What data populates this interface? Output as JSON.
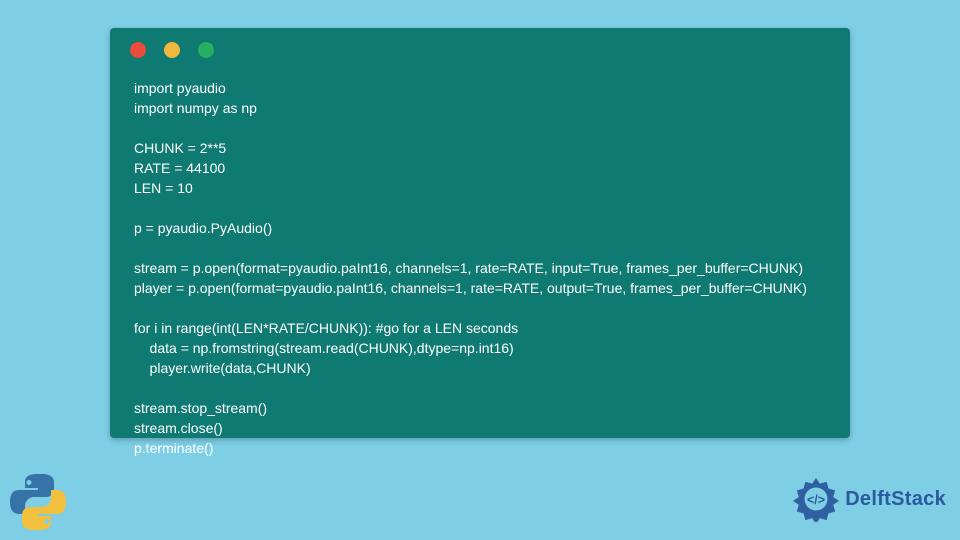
{
  "code": {
    "lines": [
      "import pyaudio",
      "import numpy as np",
      "",
      "CHUNK = 2**5",
      "RATE = 44100",
      "LEN = 10",
      "",
      "p = pyaudio.PyAudio()",
      "",
      "stream = p.open(format=pyaudio.paInt16, channels=1, rate=RATE, input=True, frames_per_buffer=CHUNK)",
      "player = p.open(format=pyaudio.paInt16, channels=1, rate=RATE, output=True, frames_per_buffer=CHUNK)",
      "",
      "for i in range(int(LEN*RATE/CHUNK)): #go for a LEN seconds",
      "    data = np.fromstring(stream.read(CHUNK),dtype=np.int16)",
      "    player.write(data,CHUNK)",
      "",
      "stream.stop_stream()",
      "stream.close()",
      "p.terminate()"
    ]
  },
  "branding": {
    "name": "DelftStack"
  }
}
